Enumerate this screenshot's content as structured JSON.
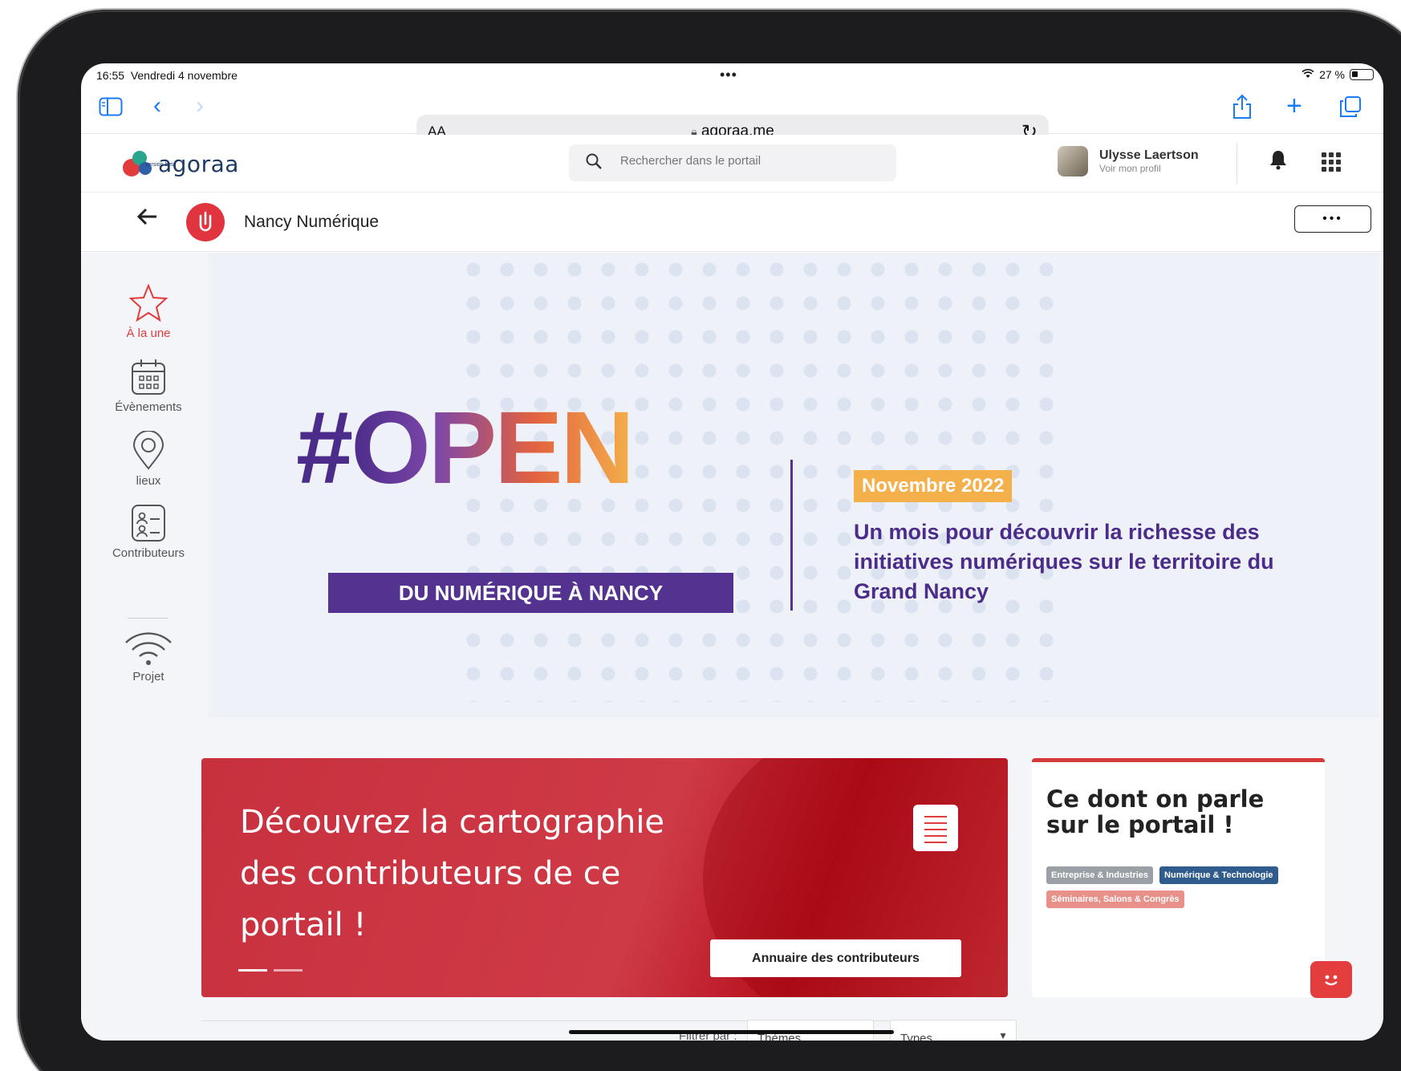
{
  "status_bar": {
    "time": "16:55",
    "date": "Vendredi 4 novembre",
    "battery": "27 %"
  },
  "safari": {
    "text_size": "AA",
    "url": "agoraa.me"
  },
  "app": {
    "logo_text": "agoraa",
    "logo_sub": "version beta",
    "search_placeholder": "Rechercher dans le portail",
    "user_name": "Ulysse Laertson",
    "user_link": "Voir mon profil"
  },
  "portal": {
    "name": "Nancy Numérique",
    "avatar_letter": "√",
    "more": "•••"
  },
  "sidebar": {
    "items": [
      {
        "label": "À la une",
        "icon": "star-icon"
      },
      {
        "label": "Évènements",
        "icon": "calendar-icon"
      },
      {
        "label": "lieux",
        "icon": "location-pin-icon"
      },
      {
        "label": "Contributeurs",
        "icon": "contributors-list-icon"
      },
      {
        "label": "Projet",
        "icon": "wifi-icon"
      }
    ]
  },
  "banner": {
    "hash": "#",
    "title": "OPEN",
    "subtitle": "DU NUMÉRIQUE À NANCY",
    "month": "Novembre 2022",
    "text": "Un mois pour découvrir la richesse des initiatives numériques sur le territoire du Grand Nancy"
  },
  "promo": {
    "title": "Découvrez la cartographie des contributeurs de ce portail !",
    "button": "Annuaire des contributeurs"
  },
  "talk": {
    "title": "Ce dont on parle sur le portail !",
    "tags": [
      {
        "label": "Entreprise & Industries",
        "color": "#9aa0a6"
      },
      {
        "label": "Numérique & Technologie",
        "color": "#2f5c8c"
      },
      {
        "label": "Séminaires, Salons & Congrès",
        "color": "#e8908a"
      }
    ]
  },
  "filters": {
    "label": "Filtrer par :",
    "theme": "Thèmes",
    "types": "Types"
  },
  "colors": {
    "brand_red": "#e23b3b",
    "purple": "#543290",
    "orange": "#f4b04b",
    "accent_blue": "#1a7cf5"
  }
}
